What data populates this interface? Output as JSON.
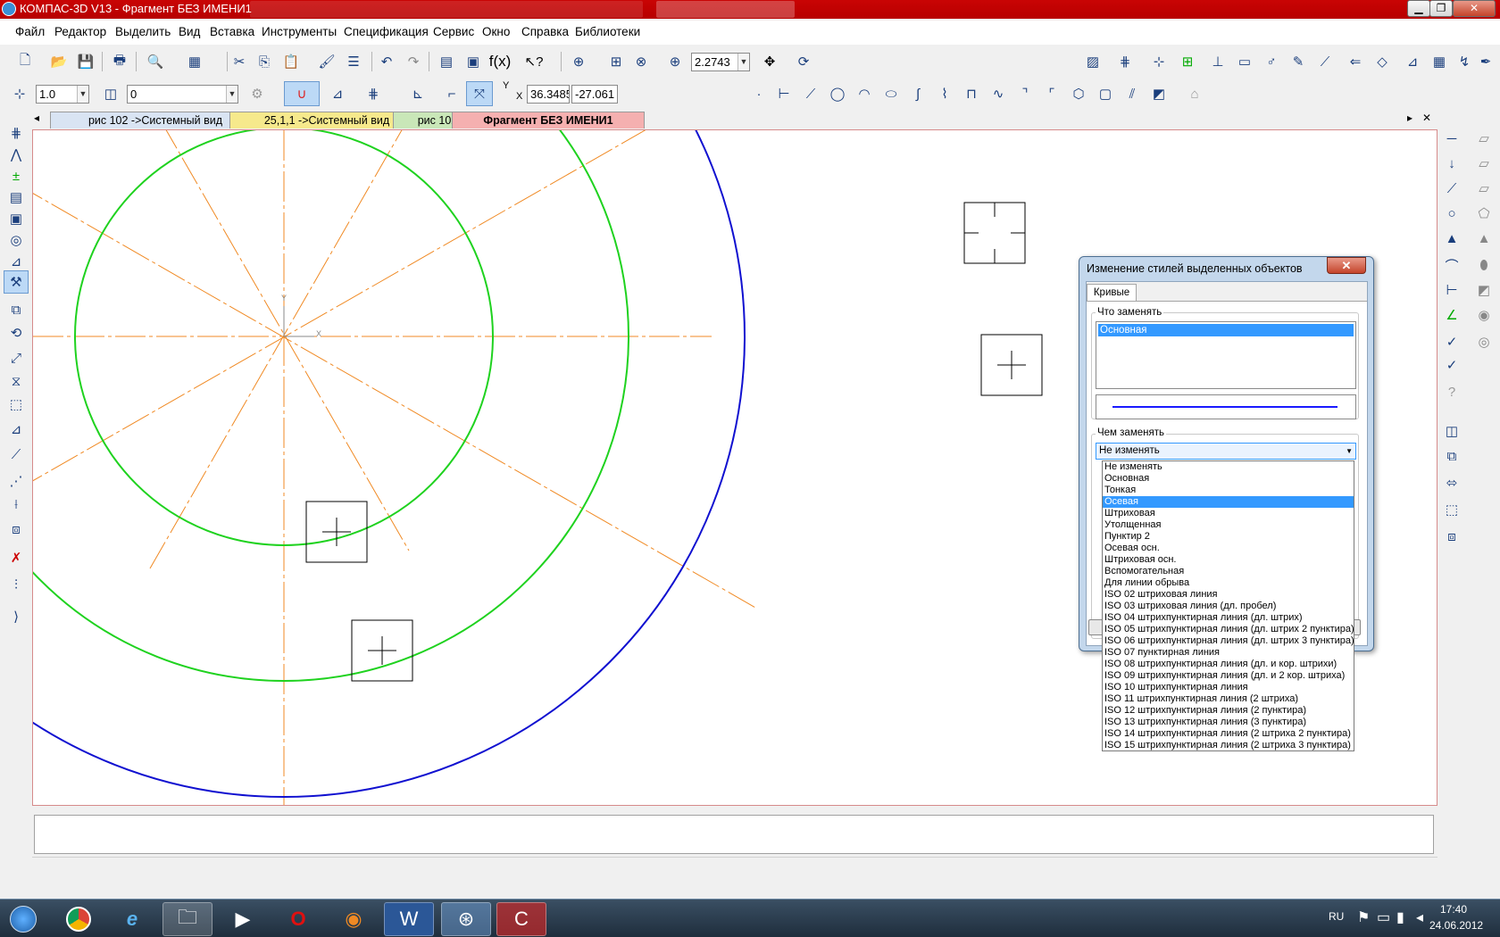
{
  "titlebar": {
    "title": "КОМПАС-3D V13 - Фрагмент БЕЗ ИМЕНИ1",
    "buttons": {
      "minimize": "▁",
      "maximize": "❐",
      "close": "✕"
    }
  },
  "menubar": {
    "items": [
      "Файл",
      "Редактор",
      "Выделить",
      "Вид",
      "Вставка",
      "Инструменты",
      "Спецификация",
      "Сервис",
      "Окно",
      "Справка",
      "Библиотеки"
    ]
  },
  "toolbar1": {
    "zoom_value": "2.2743",
    "fx_label": "f(x)"
  },
  "toolbar2": {
    "step_value": "1.0",
    "layer_value": "0",
    "coord_y_label": "Y",
    "coord_x_label": "X",
    "coord_x_value": "36.3485",
    "coord_y_value": "-27.061"
  },
  "tabs": [
    {
      "label": "рис 102 ->Системный вид",
      "color": "#d9e4f3"
    },
    {
      "label": "25,1,1 ->Системный вид",
      "color": "#f6e98c"
    },
    {
      "label": "рис 102",
      "color": "#c9e7b8"
    },
    {
      "label": "Фрагмент БЕЗ ИМЕНИ1",
      "color": "#f5b0b0",
      "active": true
    }
  ],
  "tabstrip": {
    "left_arrow": "◂",
    "right_arrow": "▸",
    "close": "✕"
  },
  "canvas": {
    "colors": {
      "axis": "#f08a24",
      "green": "#1fd21f",
      "blue": "#1010d0",
      "marker": "#000000"
    },
    "axis_labels": {
      "x": "X",
      "y": "Y"
    }
  },
  "dialog": {
    "title": "Изменение стилей выделенных объектов",
    "close": "✕",
    "tab": "Кривые",
    "what_label": "Что заменять",
    "what_items": [
      "Основная"
    ],
    "with_label": "Чем заменять",
    "with_value": "Не изменять",
    "with_options": [
      "Не изменять",
      "Основная",
      "Тонкая",
      "Осевая",
      "Штриховая",
      "Утолщенная",
      "Пунктир 2",
      "Осевая осн.",
      "Штриховая осн.",
      "Вспомогательная",
      "Для линии обрыва",
      "ISO 02 штриховая линия",
      "ISO 03 штриховая линия (дл. пробел)",
      "ISO 04 штрихпунктирная линия (дл. штрих)",
      "ISO 05 штрихпунктирная линия (дл. штрих 2 пунктира)",
      "ISO 06 штрихпунктирная линия (дл. штрих 3 пунктира)",
      "ISO 07 пунктирная линия",
      "ISO 08 штрихпунктирная линия (дл. и кор. штрихи)",
      "ISO 09 штрихпунктирная линия (дл. и 2 кор. штриха)",
      "ISO 10 штрихпунктирная линия",
      "ISO 11 штрихпунктирная линия (2 штриха)",
      "ISO 12 штрихпунктирная линия (2 пунктира)",
      "ISO 13 штрихпунктирная линия (3 пунктира)",
      "ISO 14 штрихпунктирная линия (2 штриха 2 пунктира)",
      "ISO 15 штрихпунктирная линия (2 штриха 3 пунктира)"
    ],
    "highlighted_option": "Осевая",
    "line_color": "#1a1aff"
  },
  "taskbar": {
    "language": "RU",
    "time": "17:40",
    "date": "24.06.2012"
  }
}
